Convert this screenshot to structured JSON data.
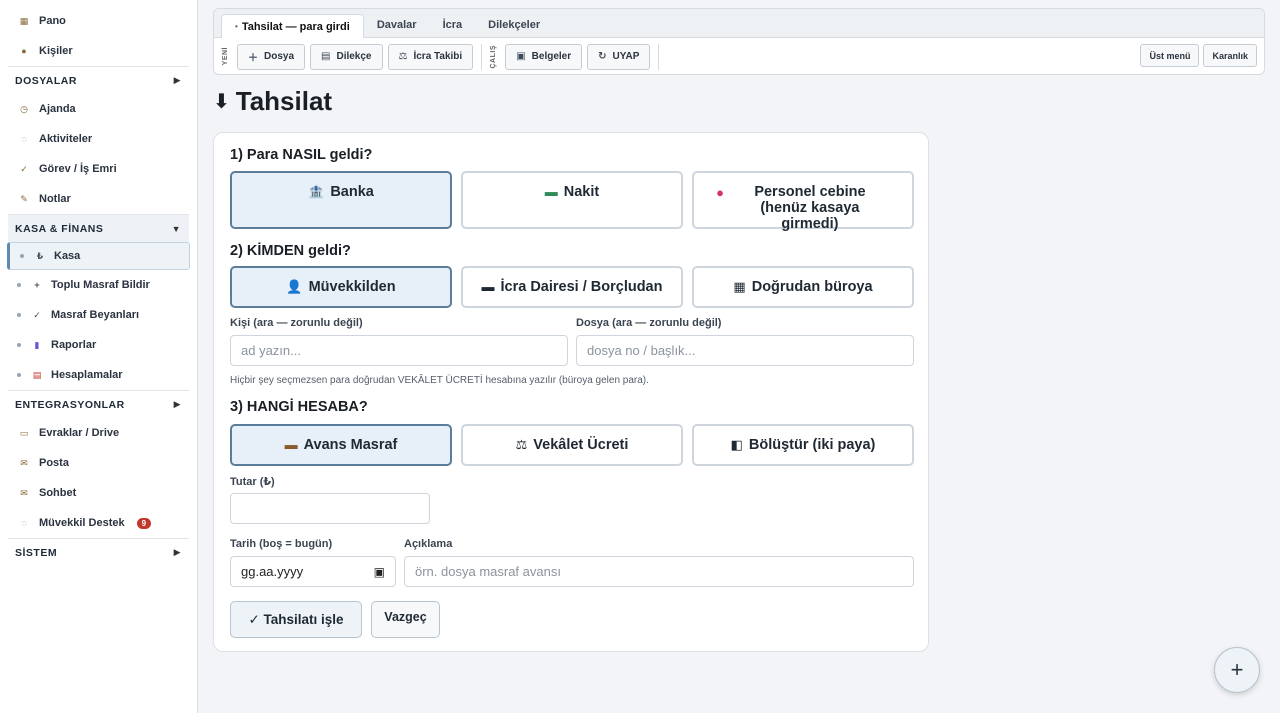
{
  "sidebar": {
    "top_items": [
      {
        "label": "Pano",
        "icon": "dashboard-icon",
        "glyph": "▦"
      },
      {
        "label": "Kişiler",
        "icon": "contacts-icon",
        "glyph": "●"
      }
    ],
    "sec_dosyalar": {
      "label": "DOSYALAR",
      "arrow": "▶"
    },
    "dosyalar_items": [
      {
        "label": "Ajanda",
        "icon": "clock-icon",
        "glyph": "◷"
      },
      {
        "label": "Aktiviteler",
        "icon": "activity-icon",
        "glyph": "◌"
      },
      {
        "label": "Görev / İş Emri",
        "icon": "check-icon",
        "glyph": "✓"
      },
      {
        "label": "Notlar",
        "icon": "pencil-icon",
        "glyph": "✎"
      }
    ],
    "sec_kasa": {
      "label": "KASA & FİNANS",
      "arrow": "▼"
    },
    "kasa_items": [
      {
        "label": "Kasa",
        "icon": "lira-icon",
        "glyph": "₺"
      },
      {
        "label": "Toplu Masraf Bildir",
        "icon": "plus-icon",
        "glyph": "+"
      },
      {
        "label": "Masraf Beyanları",
        "icon": "check-icon",
        "glyph": "✓"
      },
      {
        "label": "Raporlar",
        "icon": "bar-chart-icon",
        "glyph": "▮"
      },
      {
        "label": "Hesaplamalar",
        "icon": "calculator-icon",
        "glyph": "▤"
      }
    ],
    "sec_entegrasyonlar": {
      "label": "ENTEGRASYONLAR",
      "arrow": "▶"
    },
    "entegrasyon_items": [
      {
        "label": "Evraklar / Drive",
        "icon": "folder-icon",
        "glyph": "▭"
      },
      {
        "label": "Posta",
        "icon": "mail-icon",
        "glyph": "✉"
      },
      {
        "label": "Sohbet",
        "icon": "chat-icon",
        "glyph": "✉"
      },
      {
        "label": "Müvekkil Destek",
        "icon": "speech-bubble-icon",
        "glyph": "◌",
        "badge": "9"
      }
    ],
    "sec_sistem": {
      "label": "SİSTEM",
      "arrow": "▶"
    }
  },
  "topbar": {
    "tabs": [
      "Tahsilat — para girdi",
      "Davalar",
      "İcra",
      "Dilekçeler"
    ],
    "label_yeni": "YENİ",
    "label_calis": "ÇALIŞ",
    "btn_dosya": "Dosya",
    "btn_dilekce": "Dilekçe",
    "btn_icra": "İcra Takibi",
    "btn_belgeler": "Belgeler",
    "btn_uyap": "UYAP",
    "btn_ust_menu": "Üst menü",
    "btn_karanlik": "Karanlık"
  },
  "page": {
    "title": "Tahsilat",
    "q1": "1) Para NASIL geldi?",
    "q1_opts": [
      "Banka",
      "Nakit",
      "Personel cebine (henüz kasaya girmedi)"
    ],
    "q2": "2) KİMDEN geldi?",
    "q2_opts": [
      "Müvekkilden",
      "İcra Dairesi / Borçludan",
      "Doğrudan büroya"
    ],
    "kisi_label": "Kişi (ara — zorunlu değil)",
    "kisi_placeholder": "ad yazın...",
    "dosya_label": "Dosya (ara — zorunlu değil)",
    "dosya_placeholder": "dosya no / başlık...",
    "hint": "Hiçbir şey seçmezsen para doğrudan VEKÂLET ÜCRETİ hesabına yazılır (büroya gelen para).",
    "q3": "3) HANGİ HESABA?",
    "q3_opts": [
      "Avans Masraf",
      "Vekâlet Ücreti",
      "Bölüştür (iki paya)"
    ],
    "tutar_label": "Tutar (₺)",
    "tarih_label": "Tarih (boş = bugün)",
    "tarih_value": "gg.aa.yyyy",
    "aciklama_label": "Açıklama",
    "aciklama_placeholder": "örn. dosya masraf avansı",
    "btn_submit": "✓ Tahsilatı işle",
    "btn_cancel": "Vazgeç"
  },
  "fab": "+"
}
